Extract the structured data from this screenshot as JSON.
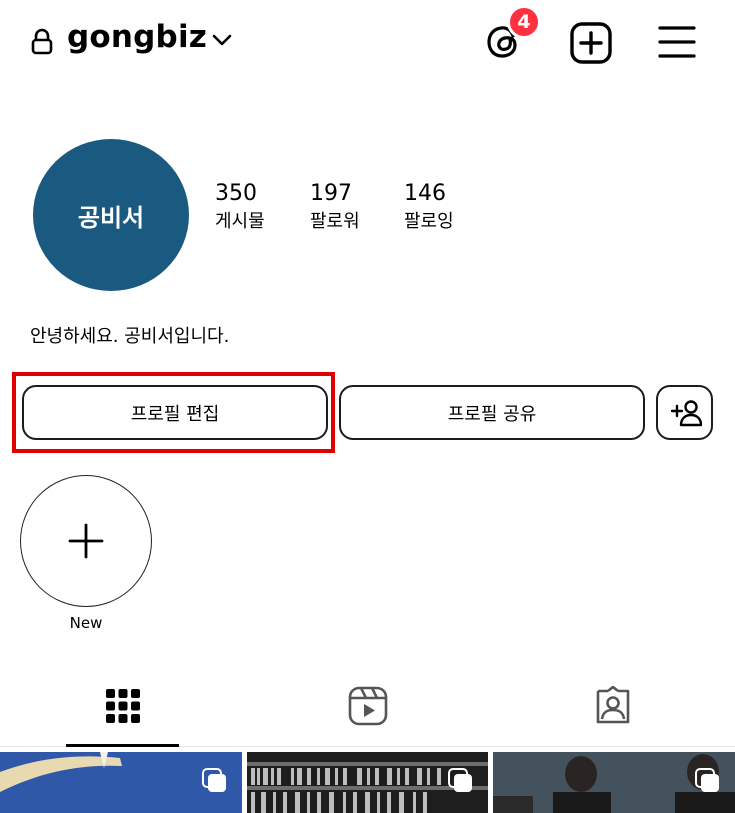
{
  "header": {
    "username": "gongbiz",
    "threads_badge": "4"
  },
  "profile": {
    "avatar_text": "공비서",
    "avatar_color": "#1a5a80",
    "stats": [
      {
        "value": "350",
        "label": "게시물"
      },
      {
        "value": "197",
        "label": "팔로워"
      },
      {
        "value": "146",
        "label": "팔로잉"
      }
    ],
    "bio": "안녕하세요. 공비서입니다."
  },
  "buttons": {
    "edit_profile": "프로필 편집",
    "share_profile": "프로필 공유"
  },
  "highlights": {
    "new_label": "New"
  },
  "tabs": [
    {
      "icon": "grid-icon",
      "active": true
    },
    {
      "icon": "reels-icon",
      "active": false
    },
    {
      "icon": "tagged-icon",
      "active": false
    }
  ],
  "accent_colors": {
    "badge": "#ff3040",
    "highlight_box": "#e00000"
  }
}
